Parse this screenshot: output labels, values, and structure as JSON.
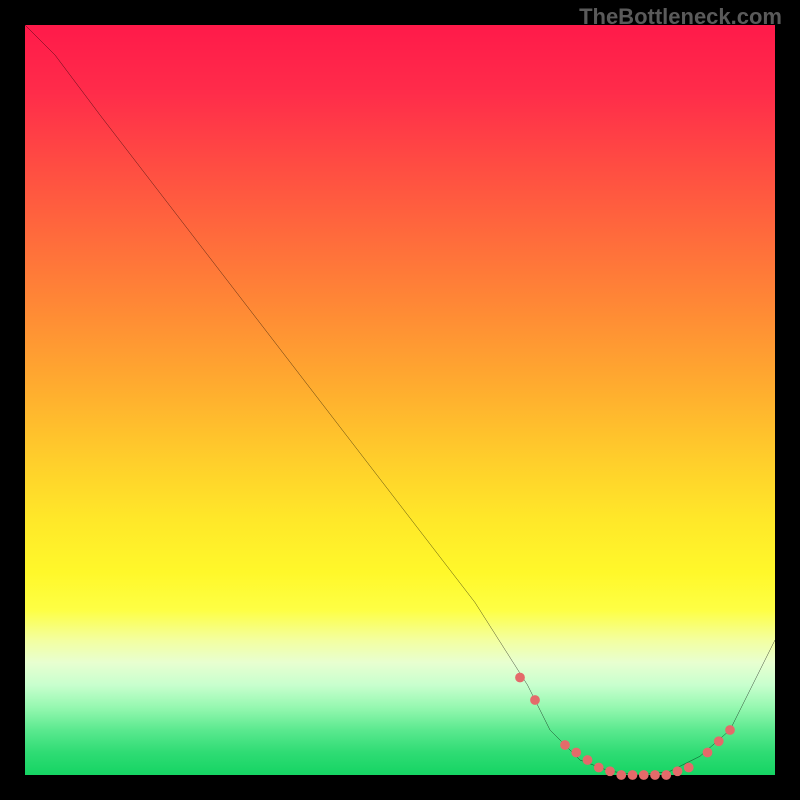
{
  "watermark": "TheBottleneck.com",
  "chart_data": {
    "type": "line",
    "title": "",
    "xlabel": "",
    "ylabel": "",
    "xlim": [
      0,
      100
    ],
    "ylim": [
      0,
      100
    ],
    "series": [
      {
        "name": "bottleneck-curve",
        "color": "#000000",
        "x": [
          0,
          4,
          10,
          20,
          30,
          40,
          50,
          60,
          67,
          70,
          74,
          78,
          82,
          86,
          90,
          94,
          100
        ],
        "y": [
          100,
          96,
          88,
          75,
          62,
          49,
          36,
          23,
          12,
          6,
          2,
          0.5,
          0,
          0.5,
          2.5,
          6,
          18
        ]
      }
    ],
    "markers": {
      "name": "highlight-points",
      "color": "#e46a6a",
      "x": [
        66,
        68,
        72,
        73.5,
        75,
        76.5,
        78,
        79.5,
        81,
        82.5,
        84,
        85.5,
        87,
        88.5,
        91,
        92.5,
        94
      ],
      "y": [
        13,
        10,
        4,
        3,
        2,
        1,
        0.5,
        0,
        0,
        0,
        0,
        0,
        0.5,
        1,
        3,
        4.5,
        6
      ]
    },
    "gradient_stops": [
      {
        "pos": 0.0,
        "color": "#ff1a4a"
      },
      {
        "pos": 0.5,
        "color": "#ffce2b"
      },
      {
        "pos": 0.8,
        "color": "#feff44"
      },
      {
        "pos": 1.0,
        "color": "#15d463"
      }
    ]
  }
}
